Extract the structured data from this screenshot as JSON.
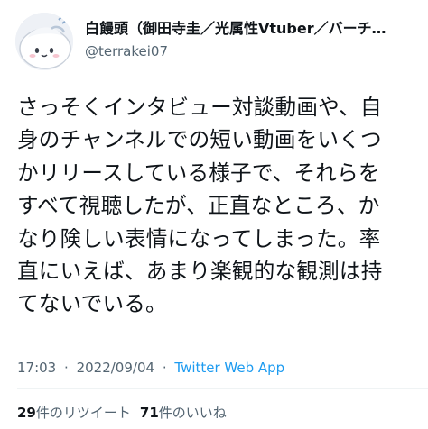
{
  "author": {
    "display_name": "白饅頭（御田寺圭／光属性Vtuber／バーチャル",
    "username": "@terrakei07"
  },
  "tweet": {
    "lines": [
      "さっそくインタビュー対談動画や、自",
      "身のチャンネルでの短い動画をいくつ",
      "かリリースしている様子で、それらを",
      "すべて視聴したが、正直なところ、か",
      "なり険しい表情になってしまった。率",
      "直にいえば、あまり楽観的な観測は持",
      "てないでいる。"
    ]
  },
  "meta": {
    "time": "17:03",
    "separator": "·",
    "date": "2022/09/04",
    "source": "Twitter Web App"
  },
  "stats": {
    "retweets_count": "29",
    "retweets_label": "件のリツイート",
    "likes_count": "71",
    "likes_label": "件のいいね"
  },
  "colors": {
    "text": "#0f1419",
    "secondary": "#536471",
    "link": "#1d9bf0"
  },
  "icons": {
    "avatar": "white-blob-character-avatar"
  }
}
